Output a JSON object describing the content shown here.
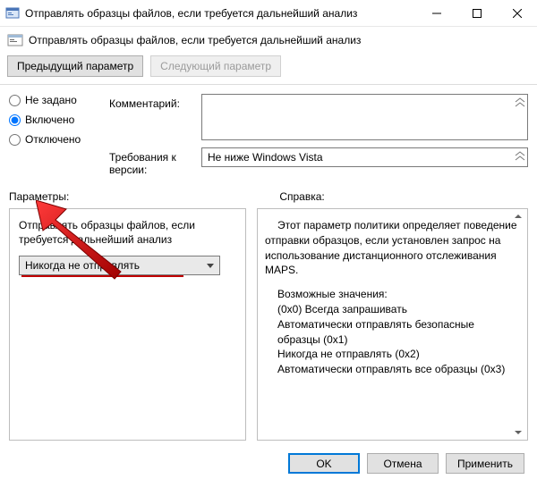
{
  "window": {
    "title": "Отправлять образцы файлов, если требуется дальнейший анализ"
  },
  "toolbar": {
    "subtitle": "Отправлять образцы файлов, если требуется дальнейший анализ"
  },
  "nav": {
    "prev": "Предыдущий параметр",
    "next": "Следующий параметр"
  },
  "radios": {
    "not_configured": "Не задано",
    "enabled": "Включено",
    "disabled": "Отключено"
  },
  "fields": {
    "comment_label": "Комментарий:",
    "version_label": "Требования к версии:",
    "version_value": "Не ниже Windows Vista"
  },
  "sections": {
    "params": "Параметры:",
    "help": "Справка:"
  },
  "param_panel": {
    "label": "Отправлять образцы файлов, если требуется дальнейший анализ",
    "combo_value": "Никогда не отправлять"
  },
  "help_panel": {
    "p1": "Этот параметр политики определяет поведение отправки образцов, если установлен запрос на использование дистанционного отслеживания MAPS.",
    "p2": "Возможные значения:",
    "l1": "(0x0) Всегда запрашивать",
    "l2": "Автоматически отправлять безопасные образцы (0x1)",
    "l3": "Никогда не отправлять (0x2)",
    "l4": "Автоматически отправлять все образцы (0x3)"
  },
  "buttons": {
    "ok": "OK",
    "cancel": "Отмена",
    "apply": "Применить"
  }
}
